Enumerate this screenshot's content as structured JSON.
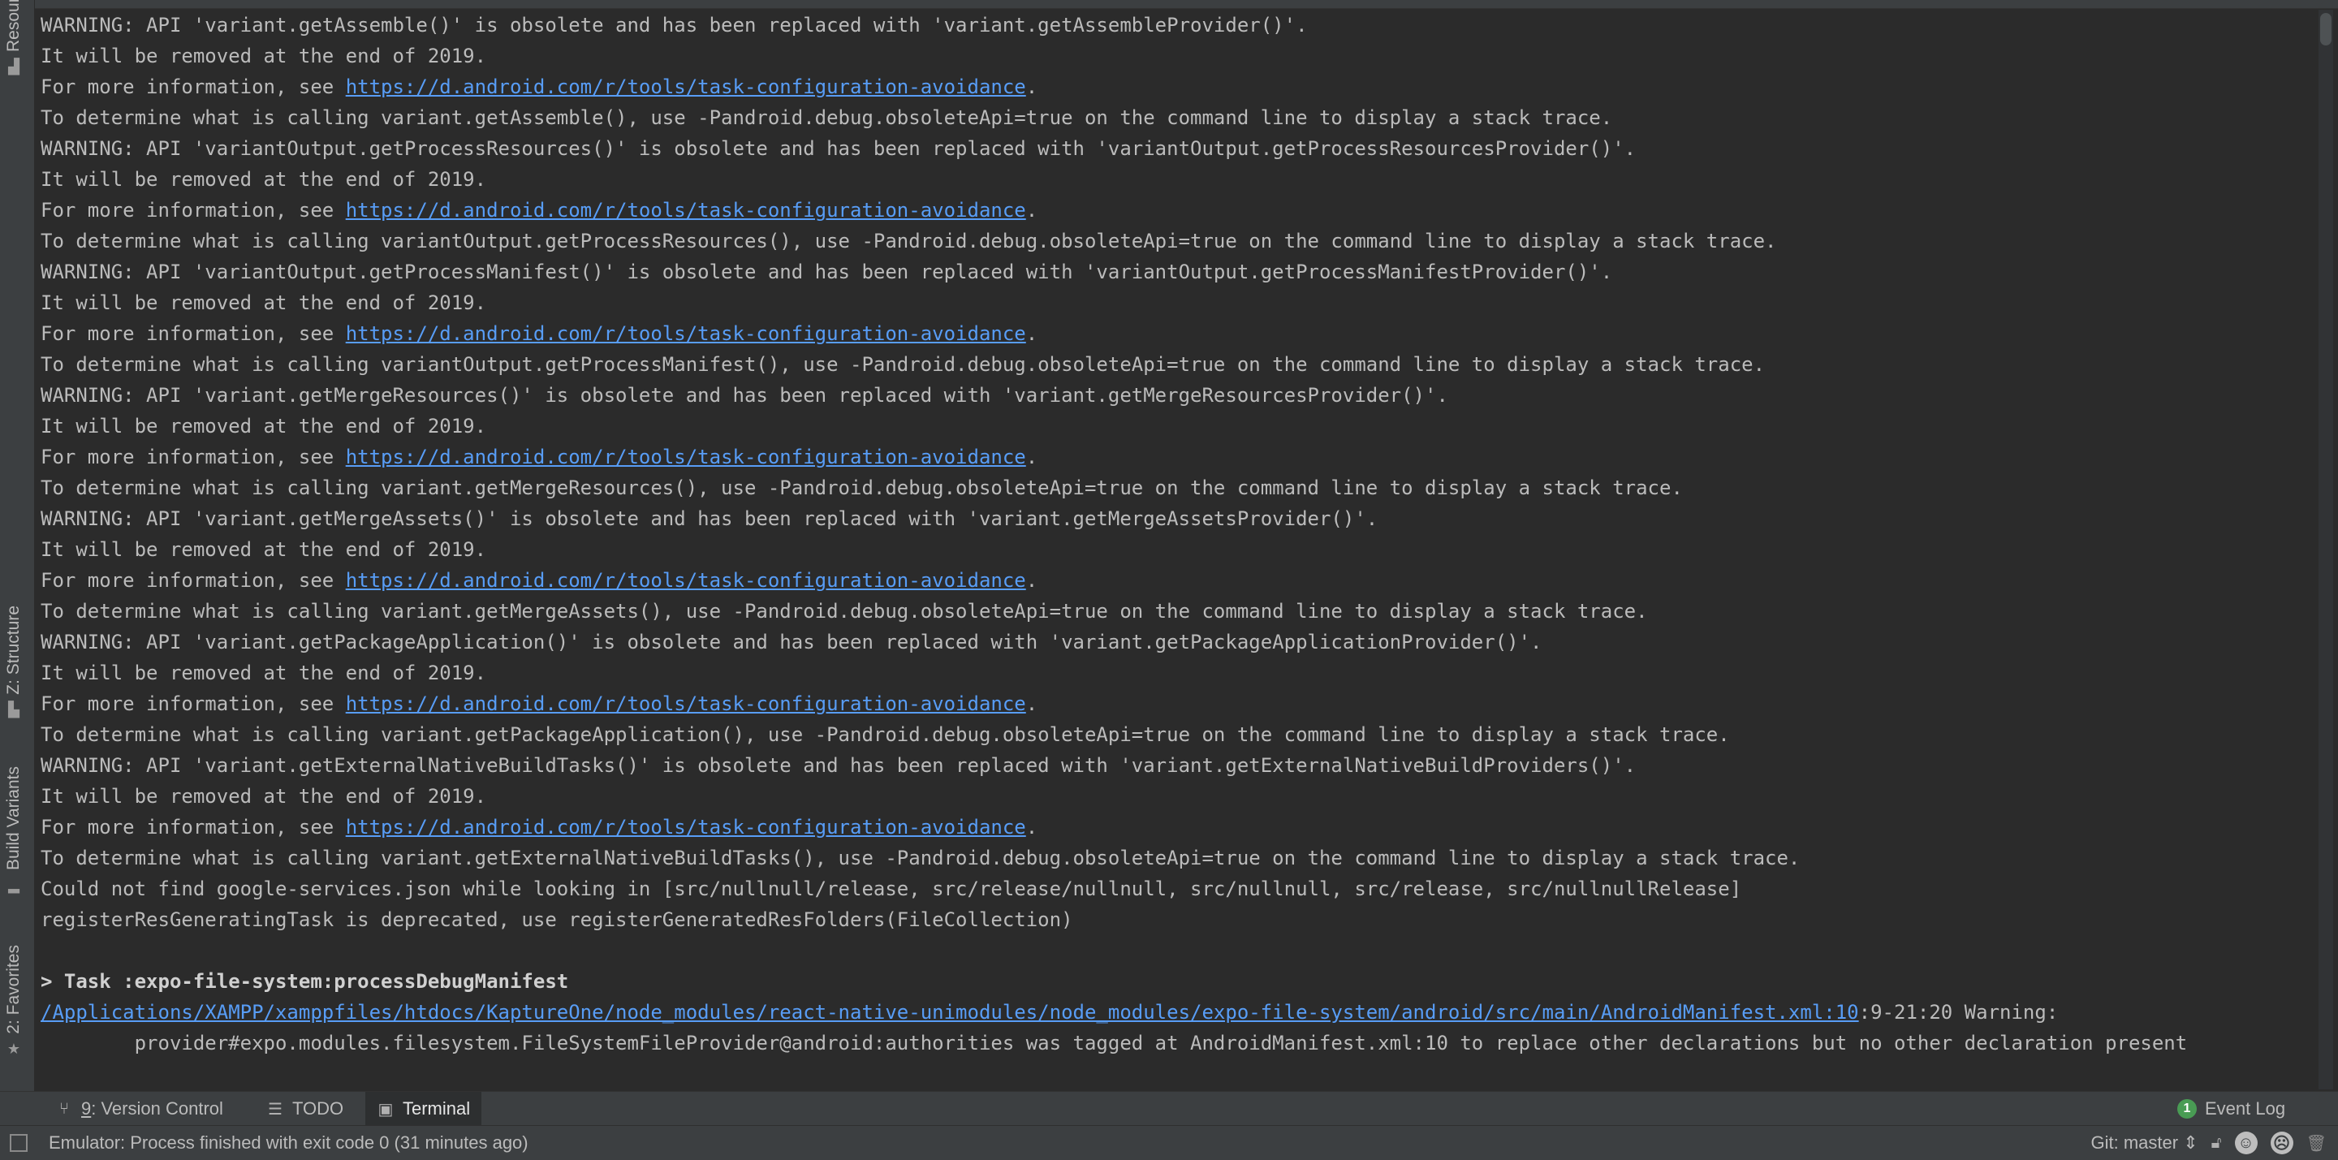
{
  "side_tabs": [
    {
      "label": "Resource Manager",
      "icon": "resource-manager-icon"
    },
    {
      "label": "Z: Structure",
      "icon": "structure-icon"
    },
    {
      "label": "Build Variants",
      "icon": "build-variants-icon"
    },
    {
      "label": "2: Favorites",
      "icon": "favorites-star-icon"
    }
  ],
  "console": {
    "lines": [
      {
        "text": "WARNING: API 'variant.getAssemble()' is obsolete and has been replaced with 'variant.getAssembleProvider()'."
      },
      {
        "text": "It will be removed at the end of 2019."
      },
      {
        "text": "For more information, see ",
        "link": "https://d.android.com/r/tools/task-configuration-avoidance",
        "after": "."
      },
      {
        "text": "To determine what is calling variant.getAssemble(), use -Pandroid.debug.obsoleteApi=true on the command line to display a stack trace."
      },
      {
        "text": "WARNING: API 'variantOutput.getProcessResources()' is obsolete and has been replaced with 'variantOutput.getProcessResourcesProvider()'."
      },
      {
        "text": "It will be removed at the end of 2019."
      },
      {
        "text": "For more information, see ",
        "link": "https://d.android.com/r/tools/task-configuration-avoidance",
        "after": "."
      },
      {
        "text": "To determine what is calling variantOutput.getProcessResources(), use -Pandroid.debug.obsoleteApi=true on the command line to display a stack trace."
      },
      {
        "text": "WARNING: API 'variantOutput.getProcessManifest()' is obsolete and has been replaced with 'variantOutput.getProcessManifestProvider()'."
      },
      {
        "text": "It will be removed at the end of 2019."
      },
      {
        "text": "For more information, see ",
        "link": "https://d.android.com/r/tools/task-configuration-avoidance",
        "after": "."
      },
      {
        "text": "To determine what is calling variantOutput.getProcessManifest(), use -Pandroid.debug.obsoleteApi=true on the command line to display a stack trace."
      },
      {
        "text": "WARNING: API 'variant.getMergeResources()' is obsolete and has been replaced with 'variant.getMergeResourcesProvider()'."
      },
      {
        "text": "It will be removed at the end of 2019."
      },
      {
        "text": "For more information, see ",
        "link": "https://d.android.com/r/tools/task-configuration-avoidance",
        "after": "."
      },
      {
        "text": "To determine what is calling variant.getMergeResources(), use -Pandroid.debug.obsoleteApi=true on the command line to display a stack trace."
      },
      {
        "text": "WARNING: API 'variant.getMergeAssets()' is obsolete and has been replaced with 'variant.getMergeAssetsProvider()'."
      },
      {
        "text": "It will be removed at the end of 2019."
      },
      {
        "text": "For more information, see ",
        "link": "https://d.android.com/r/tools/task-configuration-avoidance",
        "after": "."
      },
      {
        "text": "To determine what is calling variant.getMergeAssets(), use -Pandroid.debug.obsoleteApi=true on the command line to display a stack trace."
      },
      {
        "text": "WARNING: API 'variant.getPackageApplication()' is obsolete and has been replaced with 'variant.getPackageApplicationProvider()'."
      },
      {
        "text": "It will be removed at the end of 2019."
      },
      {
        "text": "For more information, see ",
        "link": "https://d.android.com/r/tools/task-configuration-avoidance",
        "after": "."
      },
      {
        "text": "To determine what is calling variant.getPackageApplication(), use -Pandroid.debug.obsoleteApi=true on the command line to display a stack trace."
      },
      {
        "text": "WARNING: API 'variant.getExternalNativeBuildTasks()' is obsolete and has been replaced with 'variant.getExternalNativeBuildProviders()'."
      },
      {
        "text": "It will be removed at the end of 2019."
      },
      {
        "text": "For more information, see ",
        "link": "https://d.android.com/r/tools/task-configuration-avoidance",
        "after": "."
      },
      {
        "text": "To determine what is calling variant.getExternalNativeBuildTasks(), use -Pandroid.debug.obsoleteApi=true on the command line to display a stack trace."
      },
      {
        "text": "Could not find google-services.json while looking in [src/nullnull/release, src/release/nullnull, src/nullnull, src/release, src/nullnullRelease]"
      },
      {
        "text": "registerResGeneratingTask is deprecated, use registerGeneratedResFolders(FileCollection)"
      },
      {
        "text": ""
      },
      {
        "text": "> Task :expo-file-system:processDebugManifest",
        "bold": true
      },
      {
        "text": "",
        "link": "/Applications/XAMPP/xamppfiles/htdocs/KaptureOne/node_modules/react-native-unimodules/node_modules/expo-file-system/android/src/main/AndroidManifest.xml:10",
        "after": ":9-21:20 Warning:"
      },
      {
        "text": "        provider#expo.modules.filesystem.FileSystemFileProvider@android:authorities was tagged at AndroidManifest.xml:10 to replace other declarations but no other declaration present"
      }
    ]
  },
  "toolstrip": {
    "version_control": {
      "mnemonic": "9",
      "label": ": Version Control"
    },
    "todo": {
      "label": "TODO"
    },
    "terminal": {
      "label": "Terminal"
    },
    "event_log": {
      "count": "1",
      "label": "Event Log"
    }
  },
  "statusbar": {
    "message": "Emulator: Process finished with exit code 0 (31 minutes ago)",
    "git_branch": "Git: master"
  },
  "colors": {
    "link": "#589df6",
    "background": "#2b2b2b",
    "panel": "#3c3f41",
    "badge": "#499c54"
  }
}
